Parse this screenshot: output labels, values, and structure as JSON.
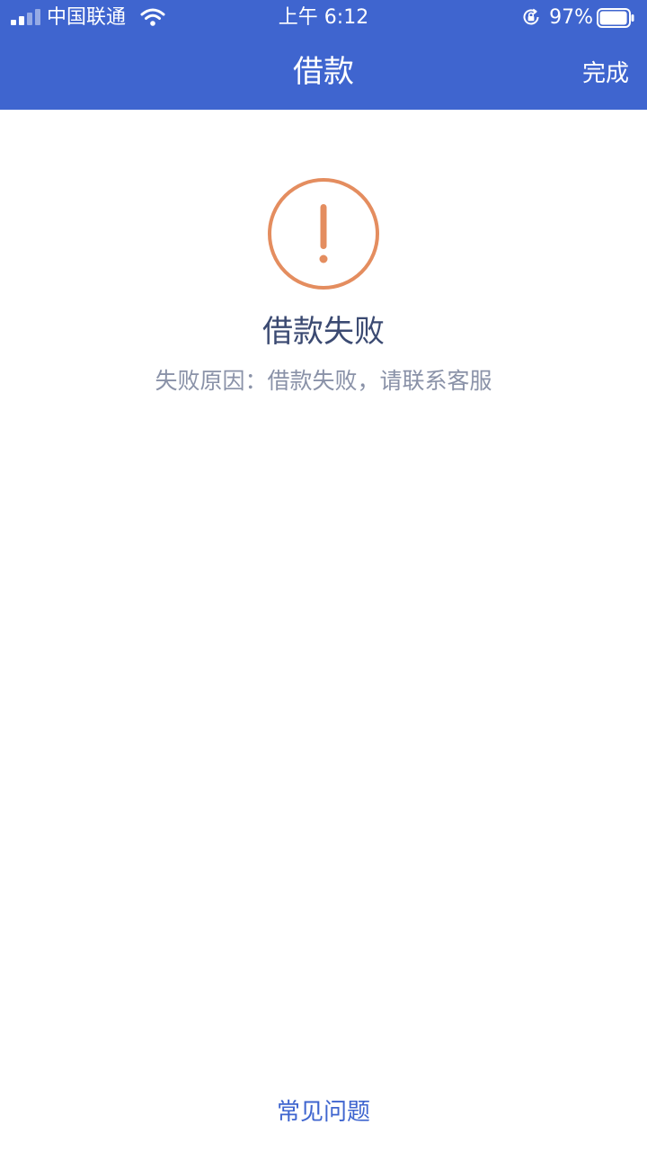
{
  "status_bar": {
    "carrier": "中国联通",
    "time": "上午 6:12",
    "battery_percent": "97%",
    "battery_level": 0.97,
    "signal_icon": "signal-strength-icon",
    "wifi_icon": "wifi-icon",
    "rotation_lock_icon": "rotation-lock-icon",
    "battery_icon": "battery-icon"
  },
  "nav": {
    "title": "借款",
    "done_label": "完成"
  },
  "result": {
    "icon": "exclamation-circle-icon",
    "title": "借款失败",
    "reason": "失败原因：借款失败，请联系客服"
  },
  "footer": {
    "faq_label": "常见问题"
  },
  "colors": {
    "header_background": "#3f65cf",
    "warning": "#e48d5f",
    "title_text": "#3b4a72",
    "secondary_text": "#8a92a8",
    "link": "#3f65cf"
  }
}
